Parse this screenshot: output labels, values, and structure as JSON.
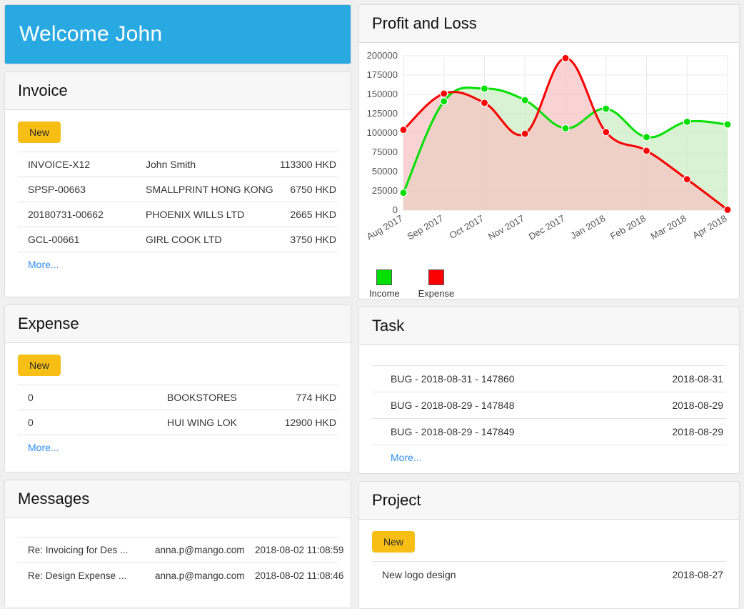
{
  "welcome": {
    "text": "Welcome John"
  },
  "invoice": {
    "title": "Invoice",
    "new_label": "New",
    "more_label": "More...",
    "rows": [
      {
        "number": "INVOICE-X12",
        "party": "John Smith",
        "amount": "113300 HKD"
      },
      {
        "number": "SPSP-00663",
        "party": "SMALLPRINT HONG KONG",
        "amount": "6750 HKD"
      },
      {
        "number": "20180731-00662",
        "party": "PHOENIX WILLS LTD",
        "amount": "2665 HKD"
      },
      {
        "number": "GCL-00661",
        "party": "GIRL COOK LTD",
        "amount": "3750 HKD"
      }
    ]
  },
  "expense": {
    "title": "Expense",
    "new_label": "New",
    "more_label": "More...",
    "rows": [
      {
        "number": "0",
        "party": "BOOKSTORES",
        "amount": "774 HKD"
      },
      {
        "number": "0",
        "party": "HUI WING LOK",
        "amount": "12900 HKD"
      }
    ]
  },
  "messages": {
    "title": "Messages",
    "rows": [
      {
        "subject": "Re: Invoicing for Des ...",
        "sender": "anna.p@mango.com",
        "timestamp": "2018-08-02 11:08:59"
      },
      {
        "subject": "Re: Design Expense ...",
        "sender": "anna.p@mango.com",
        "timestamp": "2018-08-02 11:08:46"
      }
    ]
  },
  "profit_and_loss": {
    "title": "Profit and Loss",
    "legend": [
      {
        "label": "Income",
        "color": "#00e000"
      },
      {
        "label": "Expense",
        "color": "#fa0000"
      }
    ]
  },
  "task": {
    "title": "Task",
    "more_label": "More...",
    "rows": [
      {
        "name": "BUG - 2018-08-31 - 147860",
        "date": "2018-08-31"
      },
      {
        "name": "BUG - 2018-08-29 - 147848",
        "date": "2018-08-29"
      },
      {
        "name": "BUG - 2018-08-29 - 147849",
        "date": "2018-08-29"
      }
    ]
  },
  "project": {
    "title": "Project",
    "new_label": "New",
    "rows": [
      {
        "name": "New logo design",
        "date": "2018-08-27"
      }
    ]
  },
  "chart_data": {
    "type": "area",
    "title": "Profit and Loss",
    "xlabel": "",
    "ylabel": "",
    "ylim": [
      0,
      200000
    ],
    "yticks": [
      0,
      25000,
      50000,
      75000,
      100000,
      125000,
      150000,
      175000,
      200000
    ],
    "grid": true,
    "legend_position": "bottom-left",
    "categories": [
      "Aug 2017",
      "Sep 2017",
      "Oct 2017",
      "Nov 2017",
      "Dec 2017",
      "Jan 2018",
      "Feb 2018",
      "Mar 2018",
      "Apr 2018"
    ],
    "series": [
      {
        "name": "Income",
        "color": "#00e000",
        "fill": "#c9edc2",
        "values": [
          22500,
          141000,
          157500,
          142500,
          106000,
          131500,
          94500,
          114500,
          111000
        ]
      },
      {
        "name": "Expense",
        "color": "#fa0000",
        "fill": "#f6c2c2",
        "values": [
          104000,
          151000,
          139000,
          99000,
          197000,
          101000,
          77000,
          40000,
          500
        ]
      }
    ]
  }
}
